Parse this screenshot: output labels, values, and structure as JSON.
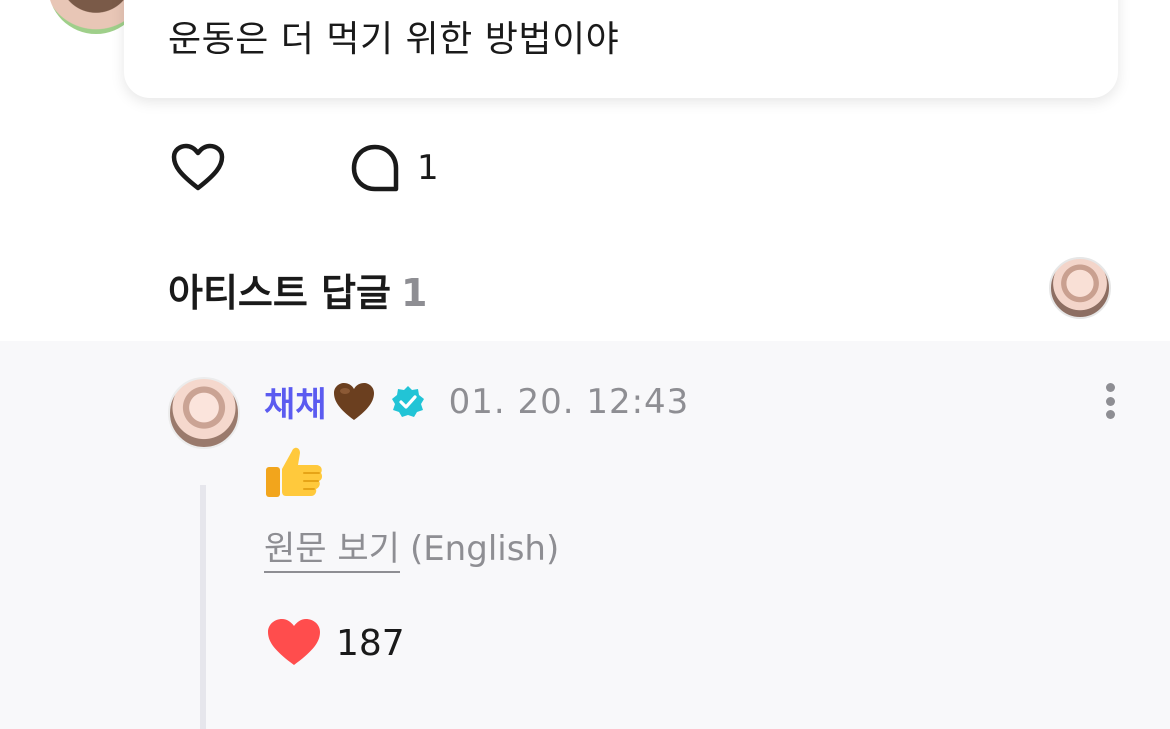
{
  "post": {
    "text": "운동은 더 먹기 위한 방법이야",
    "comment_count": "1"
  },
  "artist_replies": {
    "title": "아티스트 답글",
    "count": "1"
  },
  "reply": {
    "author": "채채",
    "timestamp": "01. 20. 12:43",
    "original_link": "원문 보기",
    "original_language": "(English)",
    "like_count": "187"
  },
  "icons": {
    "like": "heart-outline-icon",
    "comment": "comment-bubble-icon",
    "verified": "verified-badge-icon",
    "more": "more-vertical-icon",
    "brown_heart": "brown-heart-emoji",
    "thumbs_up": "thumbs-up-emoji",
    "liked": "red-heart-icon"
  },
  "colors": {
    "author_name": "#5b5bf0",
    "verified_badge": "#22c4d6",
    "liked_heart": "#ff4d4d",
    "muted_text": "#8e8e93",
    "reply_panel_bg": "#f8f8fa"
  }
}
